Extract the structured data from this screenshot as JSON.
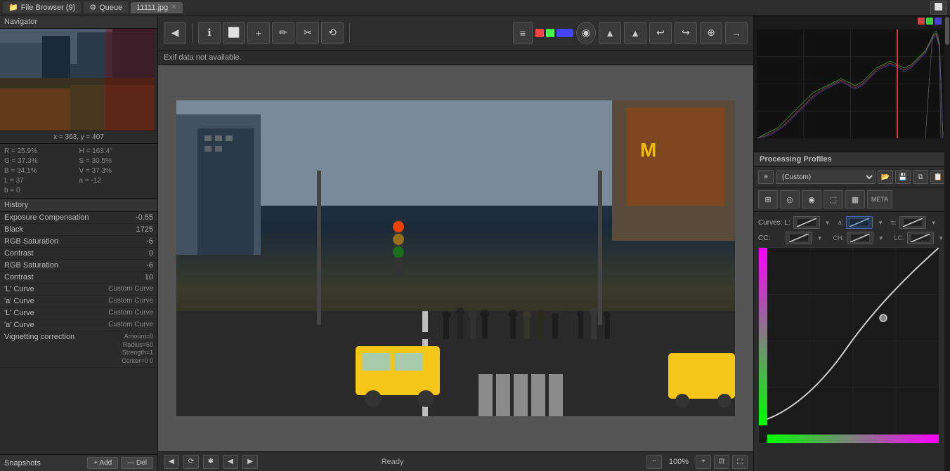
{
  "tabs": [
    {
      "label": "File Browser (9)",
      "icon": "📁",
      "active": false,
      "closable": false
    },
    {
      "label": "Queue",
      "icon": "⚙",
      "active": false,
      "closable": false
    },
    {
      "label": "11111.jpg",
      "icon": "",
      "active": true,
      "closable": true
    }
  ],
  "left_panel": {
    "navigator_label": "Navigator",
    "coords": "x = 363, y = 407",
    "color_info": [
      {
        "label": "R = 25.9%",
        "label2": "H = 163.4°"
      },
      {
        "label": "G = 37.3%",
        "label2": "S = 30.5%"
      },
      {
        "label": "B = 34.1%",
        "label2": "V = 37.3%"
      },
      {
        "label": "",
        "label2": ""
      },
      {
        "label": "L = 37",
        "label2": ""
      },
      {
        "label": "a = -12",
        "label2": ""
      },
      {
        "label": "b = 0",
        "label2": ""
      }
    ],
    "history_label": "History",
    "history_items": [
      {
        "label": "Exposure Compensation",
        "value": "-0.55"
      },
      {
        "label": "Black",
        "value": "1725"
      },
      {
        "label": "RGB Saturation",
        "value": "-6"
      },
      {
        "label": "Contrast",
        "value": "0"
      },
      {
        "label": "RGB Saturation",
        "value": "-6"
      },
      {
        "label": "Contrast",
        "value": "10"
      },
      {
        "label": "'L' Curve",
        "value": "Custom Curve"
      },
      {
        "label": "'a' Curve",
        "value": "Custom Curve"
      },
      {
        "label": "'L' Curve",
        "value": "Custom Curve"
      },
      {
        "label": "'a' Curve",
        "value": "Custom Curve"
      },
      {
        "label": "Vignetting correction",
        "value": "Amount=0\nRadius=50\nStrength=1\nCenter=0 0"
      }
    ],
    "snapshots_label": "Snapshots",
    "add_label": "+ Add",
    "remove_label": "— Del"
  },
  "toolbar": {
    "buttons": [
      "◀",
      "ℹ",
      "⬜",
      "+",
      "✏",
      "✂",
      "⟲"
    ],
    "right_buttons": [
      "≡",
      "■",
      "◉",
      "▲",
      "▲",
      "↩",
      "↪",
      "⊕",
      "→"
    ]
  },
  "exif": {
    "text": "Exif data not available."
  },
  "bottom_bar": {
    "status": "Ready",
    "zoom": "100%",
    "buttons": [
      "◀",
      "⟳",
      "✱",
      "◀",
      "▶"
    ]
  },
  "right_panel": {
    "processing_profiles_label": "Processing Profiles",
    "profile_value": "(Custom)",
    "curves": {
      "L_label": "Curves: L:",
      "a_label": "a:",
      "b_label": "b:",
      "CC_label": "CC:",
      "CH_label": "CH:",
      "LC_label": "LC:"
    },
    "tool_icons": [
      "⬜",
      "◎",
      "◉",
      "⬚",
      "▦",
      "META"
    ]
  }
}
